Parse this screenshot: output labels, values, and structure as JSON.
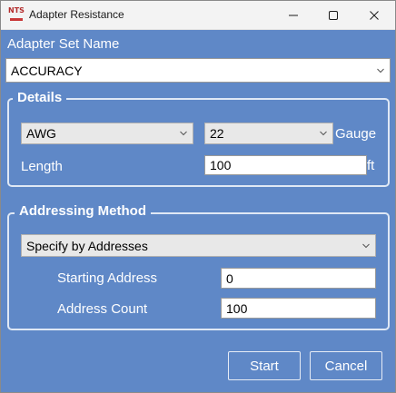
{
  "window": {
    "title": "Adapter Resistance",
    "app_icon_text": "NTS",
    "controls": {
      "minimize": "minimize-icon",
      "maximize": "maximize-icon",
      "close": "close-icon"
    }
  },
  "adapter_set": {
    "label": "Adapter Set Name",
    "value": "ACCURACY"
  },
  "details": {
    "legend": "Details",
    "wire_type": "AWG",
    "gauge_value": "22",
    "gauge_label": "Gauge",
    "length_label": "Length",
    "length_value": "100",
    "length_unit": "ft"
  },
  "addressing": {
    "legend": "Addressing Method",
    "method": "Specify by Addresses",
    "starting_address_label": "Starting Address",
    "starting_address_value": "0",
    "address_count_label": "Address Count",
    "address_count_value": "100"
  },
  "actions": {
    "start_label": "Start",
    "cancel_label": "Cancel"
  },
  "colors": {
    "background": "#5f88c7",
    "titlebar": "#f3f3f3",
    "text": "#ffffff"
  }
}
